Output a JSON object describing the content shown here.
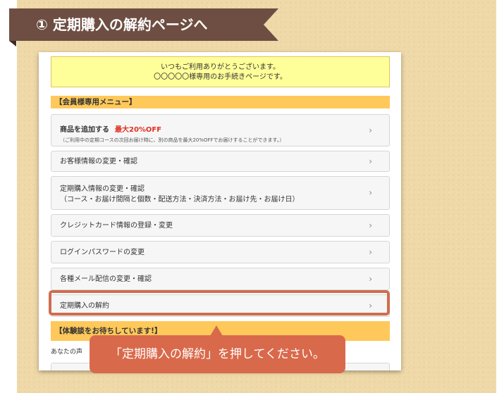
{
  "step": {
    "title": "① 定期購入の解約ページへ"
  },
  "screenshot": {
    "notice": {
      "line1": "いつもご利用ありがとうございます。",
      "line2": "〇〇〇〇〇様専用のお手続きページです。"
    },
    "menu_header": "【会員様専用メニュー】",
    "menu_items": [
      {
        "label": "商品を追加する",
        "highlight": "最大20%OFF",
        "sub": "（ご利用中の定期コースの次回お届け時に、別の商品を最大20%OFFでお届けすることができます。）"
      },
      {
        "label": "お客様情報の変更・確認"
      },
      {
        "label": "定期購入情報の変更・確認",
        "sub": "（コース・お届け間隔と個数・配送方法・決済方法・お届け先・お届け日）"
      },
      {
        "label": "クレジットカード情報の登録・変更"
      },
      {
        "label": "ログインパスワードの変更"
      },
      {
        "label": "各種メール配信の変更・確認"
      },
      {
        "label": "定期購入の解約"
      }
    ],
    "chevron": "›",
    "experience_header": "【体験談をお待ちしています!】",
    "voice_text": "あなたの声"
  },
  "callout": {
    "text": "「定期購入の解約」を押してください。"
  },
  "colors": {
    "banner": "#6e4e42",
    "callout": "#d9694b",
    "notice_bg": "#ffff99",
    "menu_header_bg": "#ffc85a",
    "discount": "#e03020"
  }
}
